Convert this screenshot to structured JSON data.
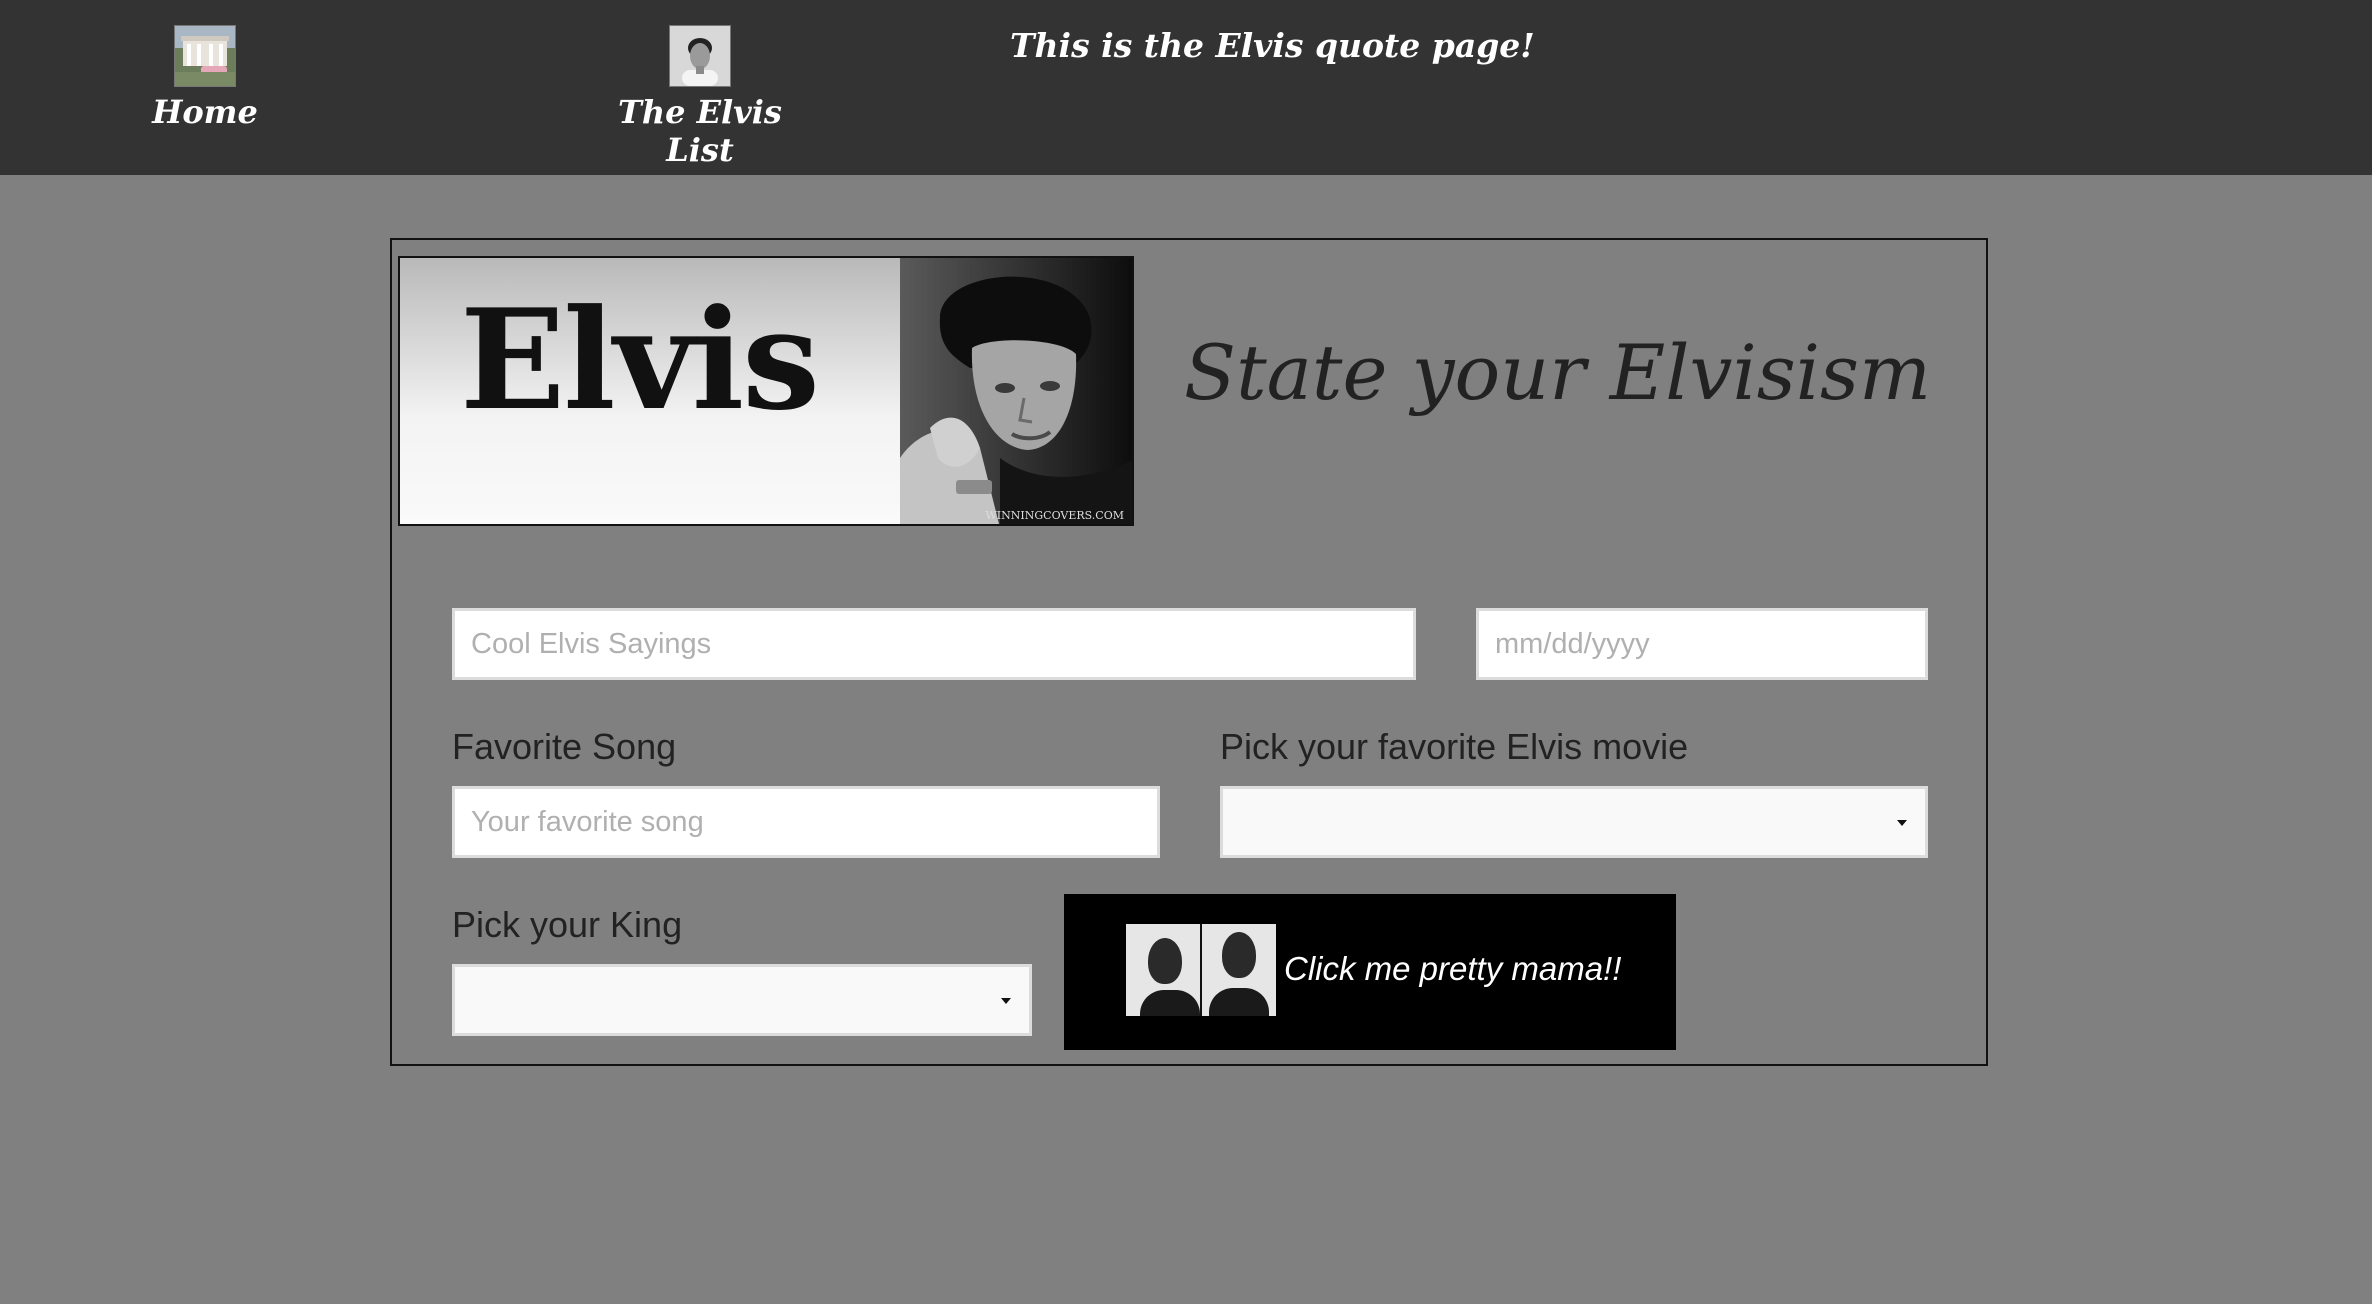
{
  "nav": {
    "home_label": "Home",
    "list_label": "The Elvis List",
    "tagline": "This is the Elvis quote page!"
  },
  "banner": {
    "word": "Elvis",
    "credit": "WINNINGCOVERS.COM"
  },
  "form": {
    "title": "State your Elvisism",
    "sayings_placeholder": "Cool Elvis Sayings",
    "date_placeholder": "mm/dd/yyyy",
    "song_label": "Favorite Song",
    "song_placeholder": "Your favorite song",
    "movie_label": "Pick your favorite Elvis movie",
    "movie_selected": "",
    "king_label": "Pick your King",
    "king_selected": "",
    "submit_label": "Click me pretty mama!!"
  },
  "colors": {
    "page_bg": "#808080",
    "navbar_bg": "#333333",
    "button_bg": "#000000"
  }
}
